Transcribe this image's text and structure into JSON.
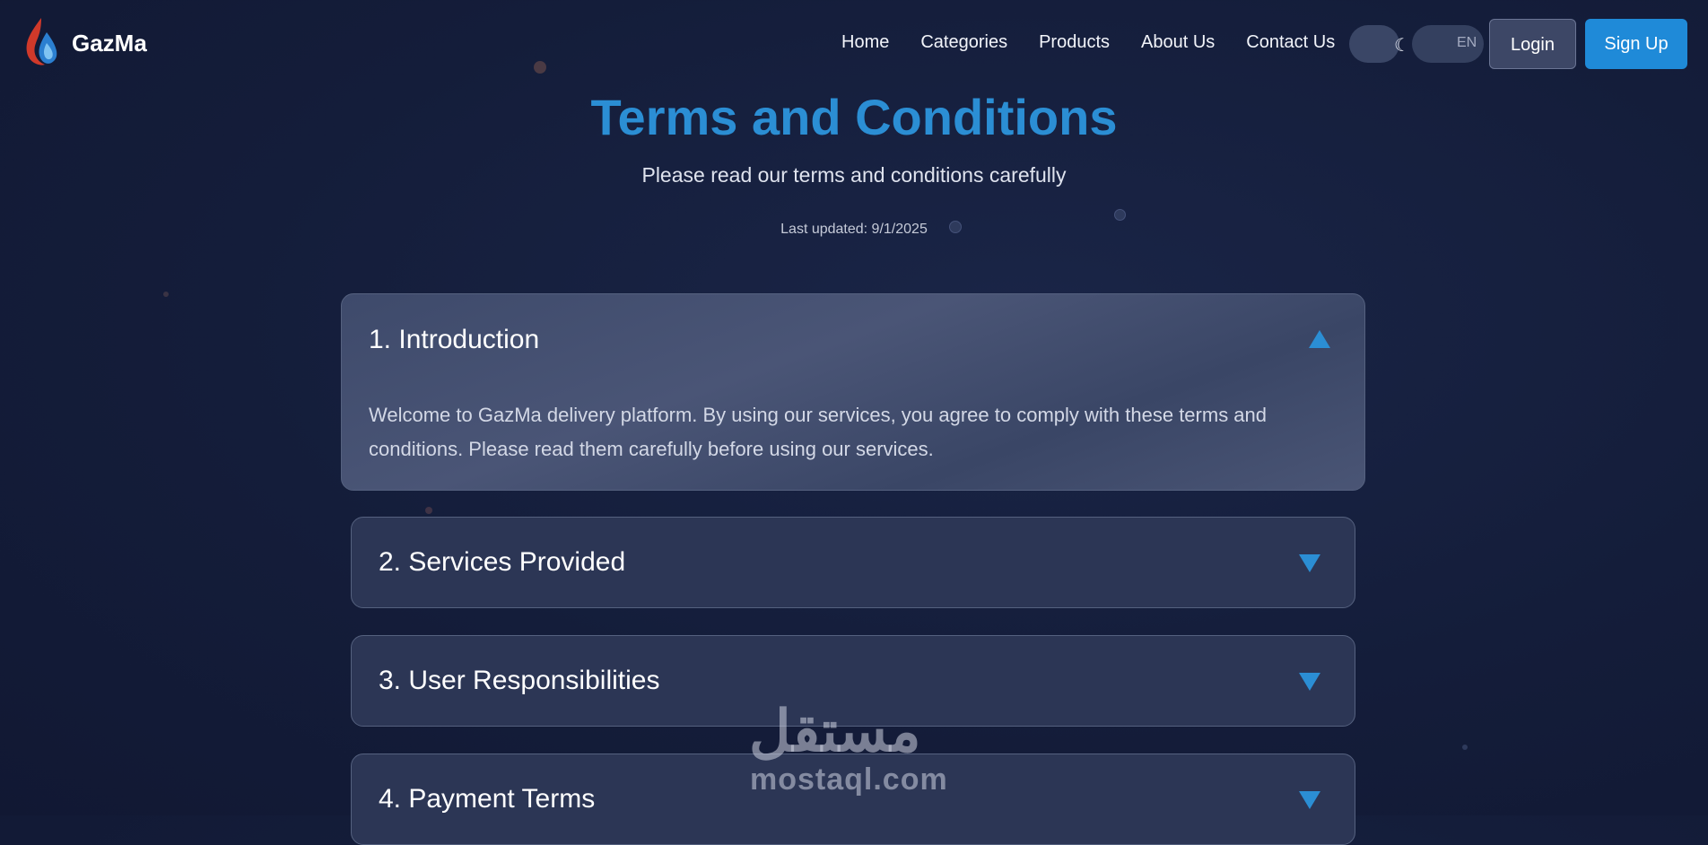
{
  "header": {
    "brand": "GazMa",
    "nav": [
      "Home",
      "Categories",
      "Products",
      "About Us",
      "Contact Us"
    ],
    "theme_icon": "moon-icon",
    "language": "EN",
    "login_label": "Login",
    "signup_label": "Sign Up"
  },
  "hero": {
    "title": "Terms and Conditions",
    "subtitle": "Please read our terms and conditions carefully",
    "last_updated": "Last updated: 9/1/2025"
  },
  "sections": [
    {
      "title": "1. Introduction",
      "expanded": true,
      "body": "Welcome to GazMa delivery platform. By using our services, you agree to comply with these terms and conditions. Please read them carefully before using our services."
    },
    {
      "title": "2. Services Provided",
      "expanded": false
    },
    {
      "title": "3. User Responsibilities",
      "expanded": false
    },
    {
      "title": "4. Payment Terms",
      "expanded": false
    }
  ],
  "watermark": {
    "arabic": "مستقل",
    "latin": "mostaql.com"
  },
  "colors": {
    "accent": "#2b8ed4",
    "background": "#141d3a",
    "signup": "#1f8ad8"
  }
}
